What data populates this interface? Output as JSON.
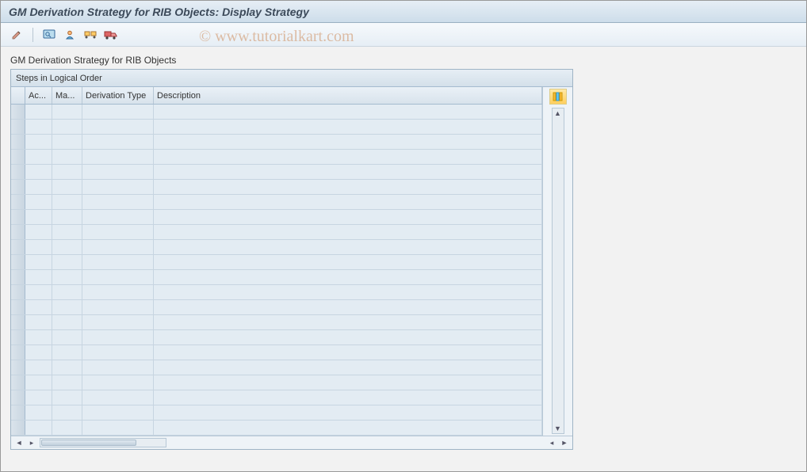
{
  "titlebar": {
    "text": "GM Derivation Strategy for RIB Objects: Display Strategy"
  },
  "toolbar": {
    "icons": {
      "edit": "pencil-icon",
      "analyze": "analyze-icon",
      "user": "user-icon",
      "transport": "transport-icon",
      "truck": "truck-icon"
    }
  },
  "section": {
    "label": "GM Derivation Strategy for RIB Objects"
  },
  "table": {
    "group_header": "Steps in Logical Order",
    "columns": {
      "ac": "Ac...",
      "ma": "Ma...",
      "type": "Derivation Type",
      "desc": "Description"
    },
    "rows": [
      {
        "ac": "",
        "ma": "",
        "type": "",
        "desc": ""
      },
      {
        "ac": "",
        "ma": "",
        "type": "",
        "desc": ""
      },
      {
        "ac": "",
        "ma": "",
        "type": "",
        "desc": ""
      },
      {
        "ac": "",
        "ma": "",
        "type": "",
        "desc": ""
      },
      {
        "ac": "",
        "ma": "",
        "type": "",
        "desc": ""
      },
      {
        "ac": "",
        "ma": "",
        "type": "",
        "desc": ""
      },
      {
        "ac": "",
        "ma": "",
        "type": "",
        "desc": ""
      },
      {
        "ac": "",
        "ma": "",
        "type": "",
        "desc": ""
      },
      {
        "ac": "",
        "ma": "",
        "type": "",
        "desc": ""
      },
      {
        "ac": "",
        "ma": "",
        "type": "",
        "desc": ""
      },
      {
        "ac": "",
        "ma": "",
        "type": "",
        "desc": ""
      },
      {
        "ac": "",
        "ma": "",
        "type": "",
        "desc": ""
      },
      {
        "ac": "",
        "ma": "",
        "type": "",
        "desc": ""
      },
      {
        "ac": "",
        "ma": "",
        "type": "",
        "desc": ""
      },
      {
        "ac": "",
        "ma": "",
        "type": "",
        "desc": ""
      },
      {
        "ac": "",
        "ma": "",
        "type": "",
        "desc": ""
      },
      {
        "ac": "",
        "ma": "",
        "type": "",
        "desc": ""
      },
      {
        "ac": "",
        "ma": "",
        "type": "",
        "desc": ""
      },
      {
        "ac": "",
        "ma": "",
        "type": "",
        "desc": ""
      },
      {
        "ac": "",
        "ma": "",
        "type": "",
        "desc": ""
      },
      {
        "ac": "",
        "ma": "",
        "type": "",
        "desc": ""
      },
      {
        "ac": "",
        "ma": "",
        "type": "",
        "desc": ""
      }
    ]
  },
  "watermark": {
    "text": "© www.tutorialkart.com"
  }
}
